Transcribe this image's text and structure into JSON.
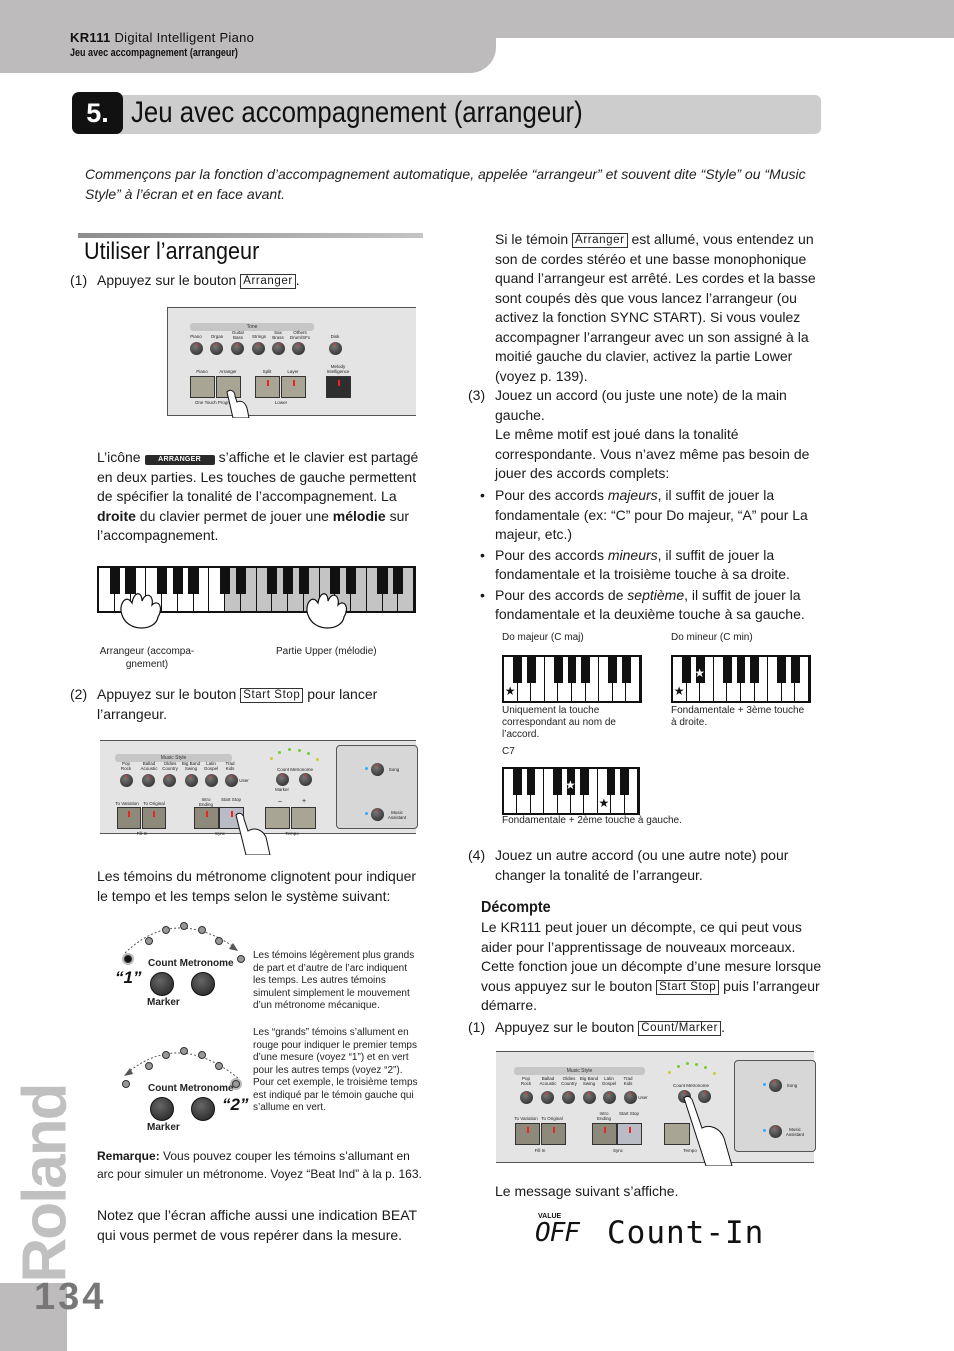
{
  "header": {
    "model": "KR111",
    "product": "Digital Intelligent Piano",
    "section": "Jeu avec accompagnement (arrangeur)"
  },
  "chapter": {
    "number": "5.",
    "title": "Jeu avec accompagnement (arrangeur)"
  },
  "intro": "Commençons par la fonction d’accompagnement automatique, appelée “arrangeur” et souvent dite “Style” ou “Music Style” à l’écran et en face avant.",
  "left": {
    "section_title": "Utiliser l’arrangeur",
    "step1": {
      "num": "(1)",
      "text": "Appuyez sur le bouton",
      "button": "Arranger",
      "after": "."
    },
    "panel1": {
      "tone_header": "Tone",
      "tone_labels": [
        "Piano",
        "Organ",
        "Guitar Bass",
        "Strings",
        "Sax Brass",
        "Others Drum/SFx"
      ],
      "disk_label": "Disk",
      "buttons": [
        "Piano",
        "Arranger",
        "Split",
        "Layer"
      ],
      "melody_label": "Melody Intelligence",
      "otp_label": "One Touch Program",
      "lower_label": "Lower"
    },
    "icon_para": {
      "pre": "L’icône",
      "icon_label": "ARRANGER",
      "s1": "s’affiche et le clavier est partagé en deux parties. Les touches de gauche permettent de spécifier la tonalité de l’accompagnement. La",
      "b1": "droite",
      "s2": "du clavier permet de jouer une",
      "b2": "mélodie",
      "s3": "sur l’accompagnement."
    },
    "keyboard_captions": {
      "left": "Arrangeur (accompa-gnement)",
      "right": "Partie Upper (mélodie)"
    },
    "step2": {
      "num": "(2)",
      "text": "Appuyez sur le bouton",
      "button": "Start Stop",
      "after": "pour lancer l’arrangeur."
    },
    "panel2": {
      "style_header": "Music Style",
      "style_labels": [
        "Pop Rock",
        "Ballad Acoustic",
        "Oldies Country",
        "Big Band Swing",
        "Latin Gospel",
        "Trad Kids"
      ],
      "user_label": "User",
      "count_metronome": "Count Metronome",
      "marker": "Marker",
      "fill_labels": [
        "To Variation",
        "To Original"
      ],
      "fill_in": "Fill In",
      "intro_ending": "Intro Ending",
      "start_stop": "Start Stop",
      "sync": "Sync",
      "minus": "–",
      "plus": "+",
      "tempo": "Tempo",
      "song": "Song",
      "music_assistant": "Music Assistant"
    },
    "metronome_para": "Les témoins du métronome clignotent pour indiquer le tempo et les temps selon le système suivant:",
    "metronome": {
      "count_metronome": "Count Metronome",
      "marker": "Marker",
      "beat1": "“1”",
      "beat2": "“2”",
      "note1": "Les témoins légèrement plus grands de part et d’autre de l’arc indiquent les temps. Les autres témoins simulent simplement le mouvement d’un métronome mécanique.",
      "note2": "Les “grands” témoins s’allument en rouge pour indiquer le premier temps d’une mesure (voyez “1”) et en vert pour les autres temps (voyez “2”). Pour cet exemple, le troisième temps est indiqué par le témoin gauche qui s’allume en vert."
    },
    "remark": {
      "label": "Remarque:",
      "text": "Vous pouvez couper les témoins s’allumant en arc pour simuler un métronome. Voyez “Beat Ind” à la p. 163."
    },
    "beat_para": "Notez que l’écran affiche aussi une indication BEAT qui vous permet de vous repérer dans la mesure."
  },
  "right": {
    "arranger_para": {
      "pre": "Si le témoin",
      "button": "Arranger",
      "text": "est allumé, vous entendez un son de cordes stéréo et une basse monophonique quand l’arrangeur est arrêté. Les cordes et la basse sont coupés dès que vous lancez l’arrangeur (ou activez la fonction SYNC START). Si vous voulez accompagner l’arrangeur avec un son assigné à la moitié gauche du clavier, activez la partie Lower (voyez p. 139)."
    },
    "step3": {
      "num": "(3)",
      "title": "Jouez un accord (ou juste une note) de la main gauche.",
      "body": "Le même motif est joué dans la tonalité correspondante. Vous n’avez même pas besoin de jouer des accords complets:",
      "bullets": [
        {
          "pre": "Pour des accords",
          "em": "majeurs",
          "post": ", il suffit de jouer la fondamentale (ex: “C” pour Do majeur, “A” pour La majeur, etc.)"
        },
        {
          "pre": "Pour des accords",
          "em": "mineurs",
          "post": ", il suffit de jouer la fondamentale et la troisième touche à sa droite."
        },
        {
          "pre": "Pour des accords de",
          "em": "septième",
          "post": ", il suffit de jouer la fondamentale et la deuxième touche à sa gauche."
        }
      ]
    },
    "chords": {
      "major_title": "Do majeur (C maj)",
      "major_caption": "Uniquement la touche correspondant au nom de l’accord.",
      "minor_title": "Do mineur (C min)",
      "minor_caption": "Fondamentale + 3ème touche à droite.",
      "seventh_title": "C7",
      "seventh_caption": "Fondamentale + 2ème touche à gauche."
    },
    "step4": {
      "num": "(4)",
      "text": "Jouez un autre accord (ou une autre note) pour changer la tonalité de l’arrangeur."
    },
    "countin": {
      "title": "Décompte",
      "body_pre": "Le KR111 peut jouer un décompte, ce qui peut vous aider pour l’apprentissage de nouveaux morceaux. Cette fonction joue un décompte d’une mesure lorsque vous appuyez sur le bouton",
      "button": "Start Stop",
      "body_post": "puis l’arrangeur démarre."
    },
    "step1b": {
      "num": "(1)",
      "text": "Appuyez sur le bouton",
      "button": "Count/Marker",
      "after": "."
    },
    "message_para": "Le message suivant s’affiche.",
    "lcd": {
      "value_label": "VALUE",
      "value": "OFF",
      "message": "Count-In"
    }
  },
  "footer": {
    "brand": "Roland",
    "page": "134"
  }
}
